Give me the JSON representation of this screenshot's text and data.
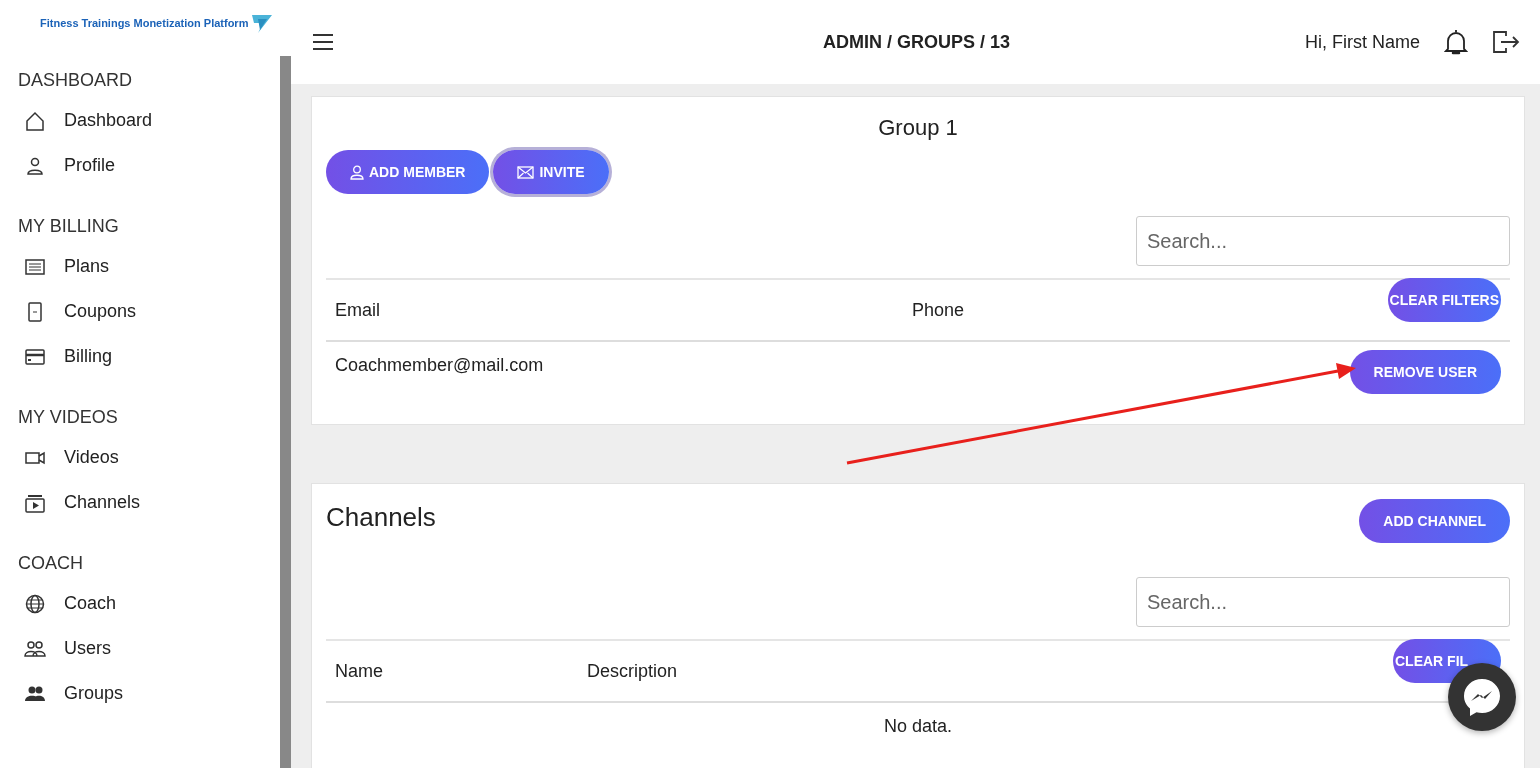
{
  "logo": {
    "text": "Fitness Trainings Monetization Platform"
  },
  "sidebar": {
    "sections": [
      {
        "title": "DASHBOARD",
        "items": [
          {
            "label": "Dashboard"
          },
          {
            "label": "Profile"
          }
        ]
      },
      {
        "title": "MY BILLING",
        "items": [
          {
            "label": "Plans"
          },
          {
            "label": "Coupons"
          },
          {
            "label": "Billing"
          }
        ]
      },
      {
        "title": "MY VIDEOS",
        "items": [
          {
            "label": "Videos"
          },
          {
            "label": "Channels"
          }
        ]
      },
      {
        "title": "COACH",
        "items": [
          {
            "label": "Coach"
          },
          {
            "label": "Users"
          },
          {
            "label": "Groups"
          }
        ]
      }
    ]
  },
  "header": {
    "breadcrumb": "ADMIN / GROUPS / 13",
    "greeting": "Hi, First Name"
  },
  "group": {
    "title": "Group 1",
    "actions": [
      {
        "label": "ADD MEMBER",
        "focused": false
      },
      {
        "label": "INVITE",
        "focused": true
      }
    ],
    "search": {
      "placeholder": "Search..."
    },
    "table": {
      "columns": [
        "Email",
        "Phone"
      ],
      "clear_button": "CLEAR FILTERS",
      "rows": [
        {
          "email": "Coachmember@mail.com",
          "action": "REMOVE USER"
        }
      ]
    }
  },
  "channels": {
    "title": "Channels",
    "add_button": "ADD CHANNEL",
    "search": {
      "placeholder": "Search..."
    },
    "table": {
      "columns": [
        "Name",
        "Description"
      ],
      "clear_button": "CLEAR FIL",
      "empty_text": "No data."
    }
  }
}
